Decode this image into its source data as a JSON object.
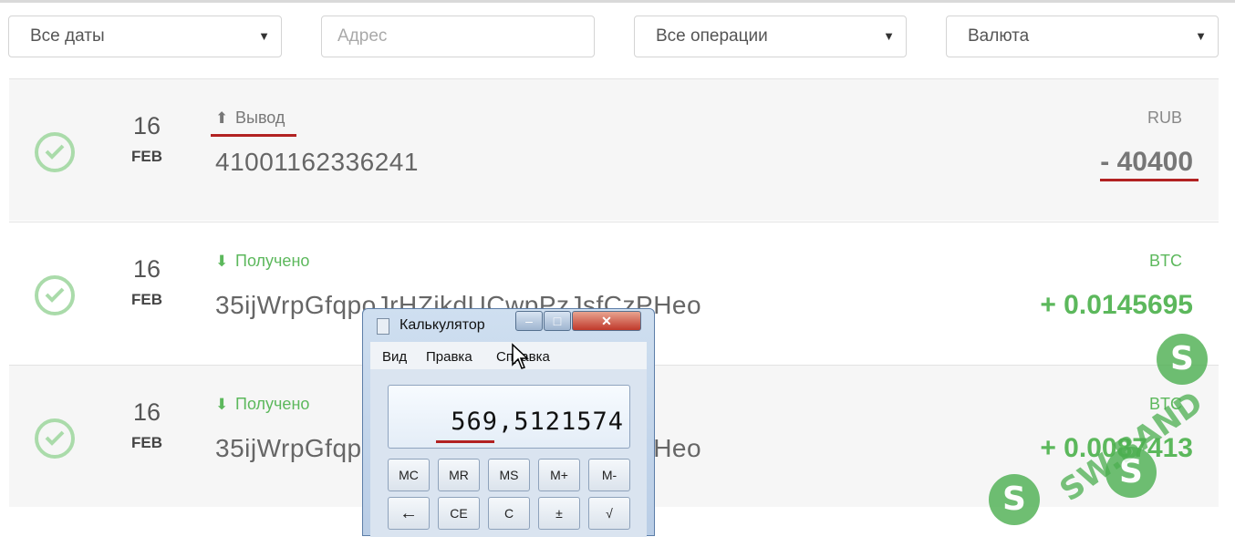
{
  "filters": {
    "dates": "Все даты",
    "address_placeholder": "Адрес",
    "operations": "Все операции",
    "currency": "Валюта"
  },
  "transactions": [
    {
      "day": "16",
      "month": "FEB",
      "type": "Вывод",
      "type_icon": "upload-icon",
      "address": "41001162336241",
      "currency": "RUB",
      "amount": "- 40400"
    },
    {
      "day": "16",
      "month": "FEB",
      "type": "Получено",
      "type_icon": "download-icon",
      "address": "35ijWrpGfqpoJrHZikdUCwpPzJsfCzPHeo",
      "currency": "BTC",
      "amount": "+ 0.0145695"
    },
    {
      "day": "16",
      "month": "FEB",
      "type": "Получено",
      "type_icon": "download-icon",
      "address": "35ijWrpGfqpoJrHZikdUCwpPzJsfCzPHeo",
      "currency": "BTC",
      "amount": "+ 0.0087413"
    }
  ],
  "calculator": {
    "title": "Калькулятор",
    "menu": [
      "Вид",
      "Правка",
      "Справка"
    ],
    "display": "569,5121574",
    "keys_row1": [
      "MC",
      "MR",
      "MS",
      "M+",
      "M-"
    ],
    "keys_row2": [
      "←",
      "CE",
      "C",
      "±",
      "√"
    ]
  },
  "watermark": {
    "text": "SW.BAND",
    "logo_letter": "S"
  },
  "colors": {
    "success_green": "#5cb85c",
    "check_green": "#aadbaa",
    "underline_red": "#b22222",
    "row_gray": "#f6f6f6"
  }
}
